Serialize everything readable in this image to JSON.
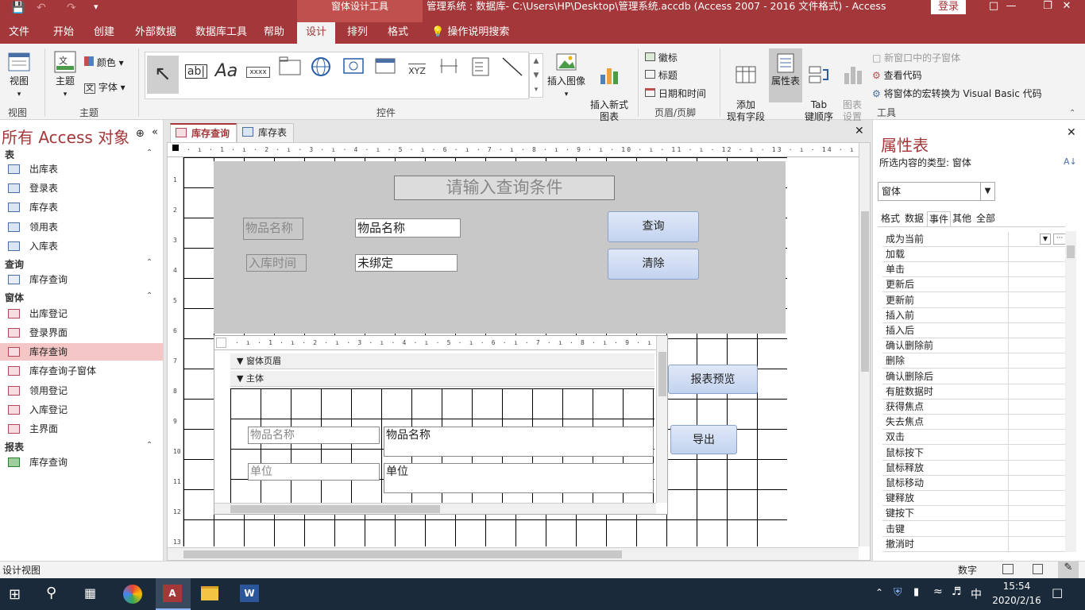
{
  "titlebar": {
    "context_tab": "窗体设计工具",
    "title": "管理系统 : 数据库- C:\\Users\\HP\\Desktop\\管理系统.accdb (Access 2007 - 2016 文件格式)  -  Access",
    "login": "登录"
  },
  "menu": {
    "tabs": [
      "文件",
      "开始",
      "创建",
      "外部数据",
      "数据库工具",
      "帮助",
      "设计",
      "排列",
      "格式"
    ],
    "active": "设计",
    "tell_me": "操作说明搜索"
  },
  "ribbon": {
    "view": {
      "label": "视图",
      "group": "视图"
    },
    "theme": {
      "label": "主题",
      "color": "颜色",
      "font": "字体",
      "group": "主题"
    },
    "controls": {
      "group": "控件",
      "items": [
        "ab|",
        "Aa",
        "xxxx",
        "XYZ"
      ]
    },
    "insert_image": "插入图像",
    "insert_chart": "插入新式\n图表",
    "header_footer": {
      "logo": "徽标",
      "title": "标题",
      "datetime": "日期和时间",
      "group": "页眉/页脚"
    },
    "add_field": "添加\n现有字段",
    "property_sheet": "属性表",
    "tab_order": "Tab\n键顺序",
    "chart_settings": "图表\n设置",
    "tools": {
      "subform_new_window": "新窗口中的子窗体",
      "view_code": "查看代码",
      "convert_macro": "将窗体的宏转换为 Visual Basic 代码",
      "group": "工具"
    }
  },
  "nav": {
    "title": "所有 Access 对象",
    "sections": [
      {
        "name": "表",
        "items": [
          "出库表",
          "登录表",
          "库存表",
          "领用表",
          "入库表"
        ]
      },
      {
        "name": "查询",
        "items": [
          "库存查询"
        ]
      },
      {
        "name": "窗体",
        "items": [
          "出库登记",
          "登录界面",
          "库存查询",
          "库存查询子窗体",
          "领用登记",
          "入库登记",
          "主界面"
        ]
      },
      {
        "name": "报表",
        "items": [
          "库存查询"
        ]
      }
    ],
    "selected": "库存查询"
  },
  "doc_tabs": [
    "库存查询",
    "库存表"
  ],
  "form": {
    "heading": "请输入查询条件",
    "label_name": "物品名称",
    "field_name": "物品名称",
    "label_date": "入库时间",
    "field_date": "未绑定",
    "btn_query": "查询",
    "btn_clear": "清除",
    "btn_report": "报表预览",
    "btn_export": "导出"
  },
  "subform": {
    "page_header": "窗体页眉",
    "detail": "主体",
    "label_name": "物品名称",
    "field_name": "物品名称",
    "label_unit": "单位",
    "field_unit": "单位"
  },
  "props": {
    "title": "属性表",
    "type_label": "所选内容的类型: 窗体",
    "selector": "窗体",
    "tabs": [
      "格式",
      "数据",
      "事件",
      "其他",
      "全部"
    ],
    "active_tab": "事件",
    "rows": [
      "成为当前",
      "加载",
      "单击",
      "更新后",
      "更新前",
      "插入前",
      "插入后",
      "确认删除前",
      "删除",
      "确认删除后",
      "有脏数据时",
      "获得焦点",
      "失去焦点",
      "双击",
      "鼠标按下",
      "鼠标释放",
      "鼠标移动",
      "键释放",
      "键按下",
      "击键",
      "撤消时"
    ]
  },
  "status": {
    "left": "设计视图",
    "numlock": "数字"
  },
  "taskbar": {
    "time": "15:54",
    "date": "2020/2/16",
    "ime": "中"
  }
}
